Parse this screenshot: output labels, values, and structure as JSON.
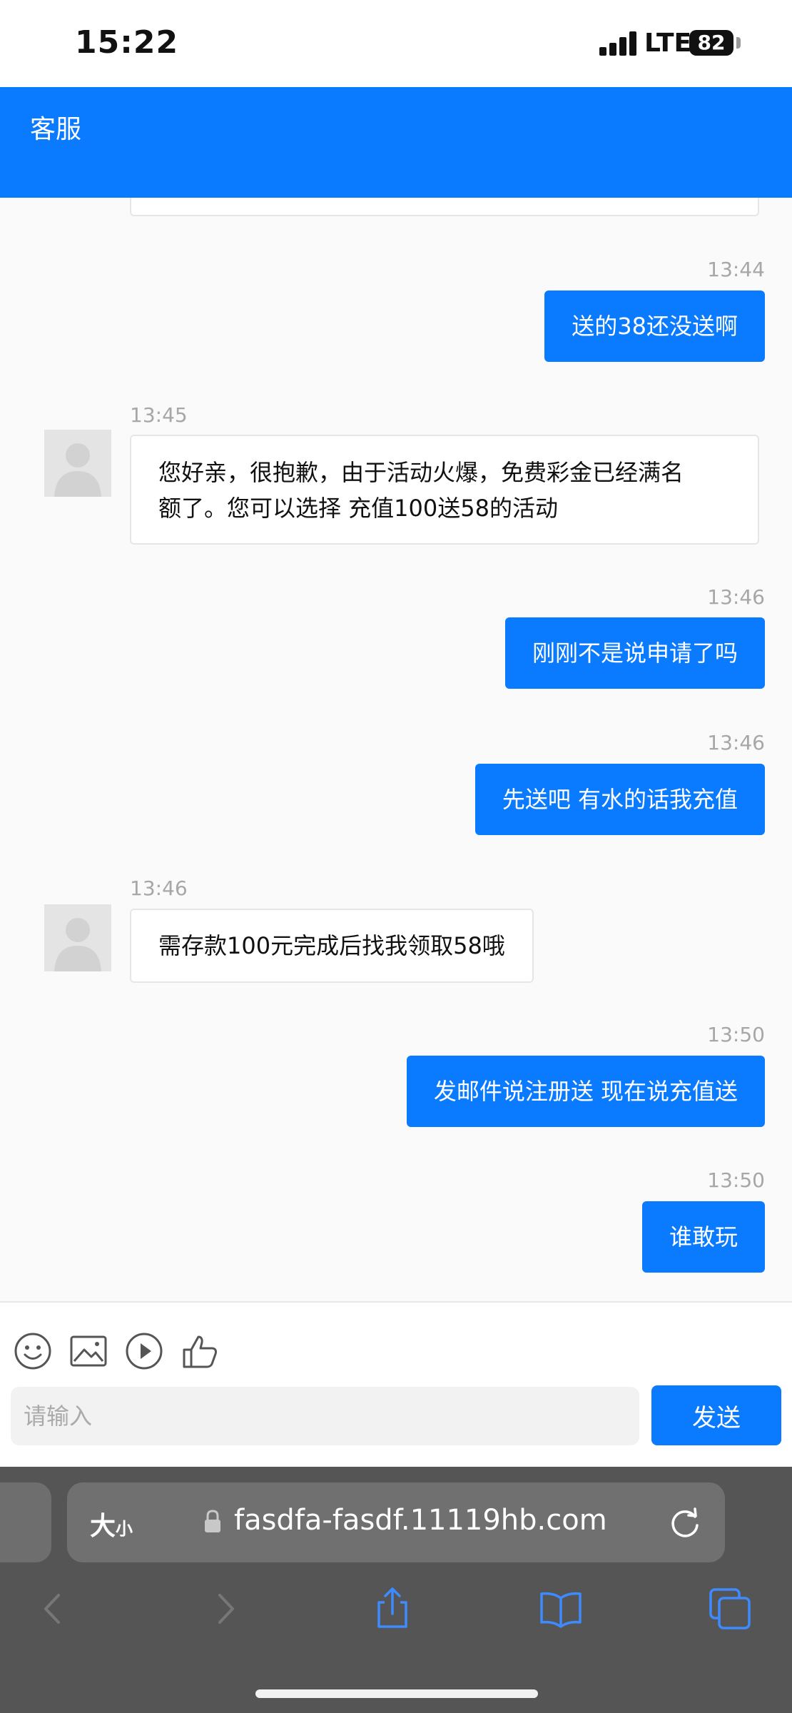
{
  "status_bar": {
    "time": "15:22",
    "network": "LTE",
    "battery": "82"
  },
  "header": {
    "title": "客服"
  },
  "messages": [
    {
      "time": "13:44",
      "text": "送的38还没送啊"
    },
    {
      "time": "13:45",
      "lines": [
        "您好亲，很抱歉，由于活动火爆，免费彩金已经满名",
        "额了。您可以选择 充值100送58的活动"
      ]
    },
    {
      "time": "13:46",
      "text": "刚刚不是说申请了吗"
    },
    {
      "time": "13:46",
      "text": "先送吧 有水的话我充值"
    },
    {
      "time": "13:46",
      "text": "需存款100元完成后找我领取58哦"
    },
    {
      "time": "13:50",
      "text": "发邮件说注册送 现在说充值送"
    },
    {
      "time": "13:50",
      "text": "谁敢玩"
    }
  ],
  "input": {
    "placeholder": "请输入",
    "send_label": "发送"
  },
  "browser": {
    "aa_label": "大",
    "aa_small": "小",
    "url": "fasdfa-fasdf.11119hb.com"
  },
  "colors": {
    "accent": "#0a7aff",
    "chrome": "#555555"
  }
}
